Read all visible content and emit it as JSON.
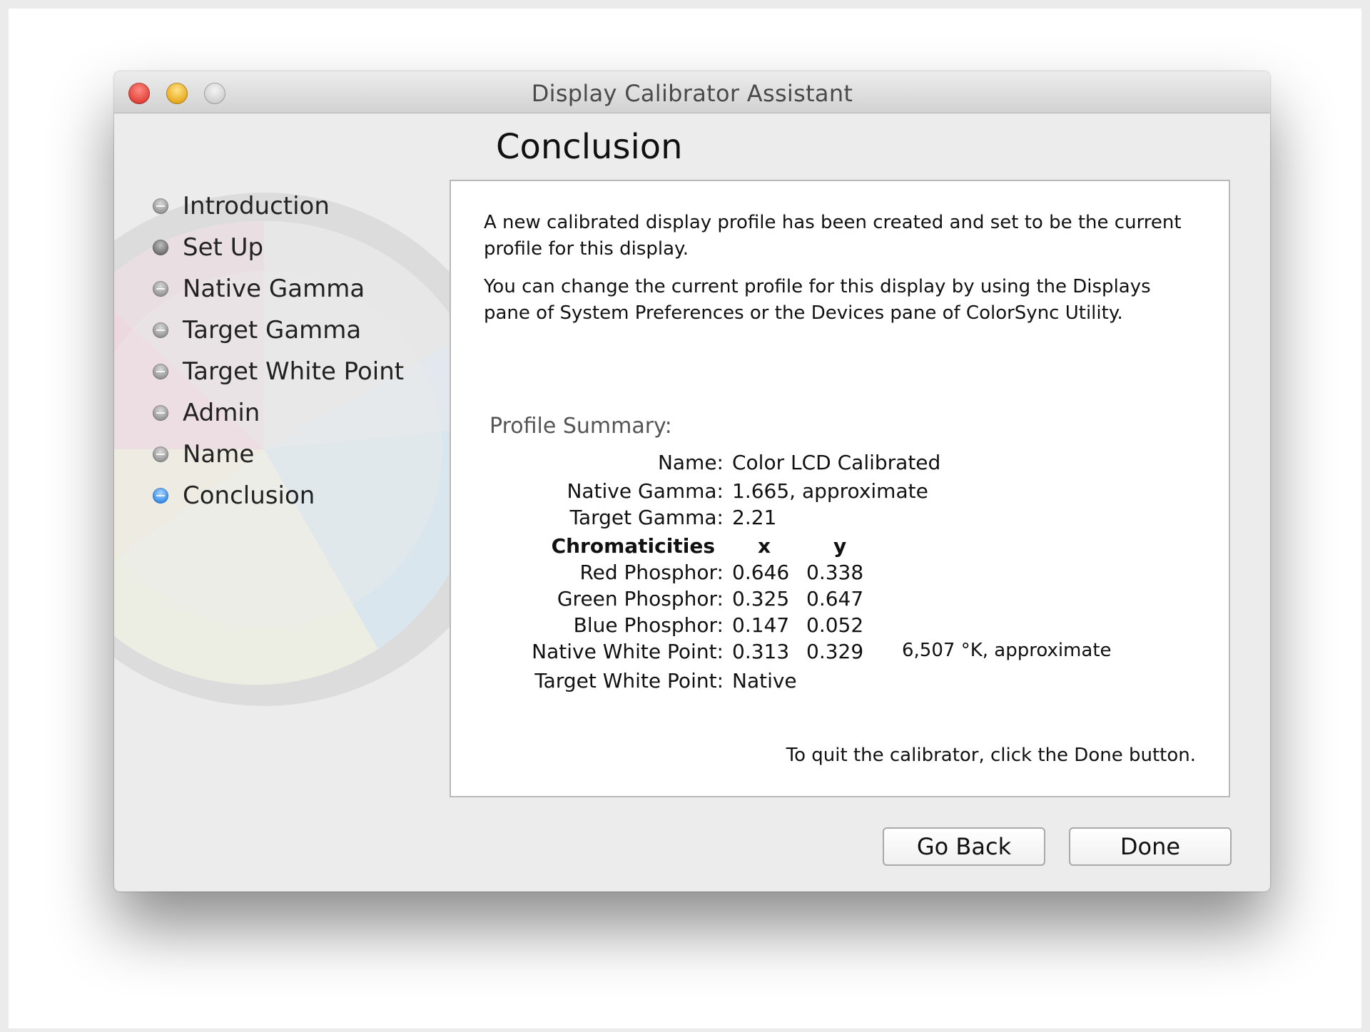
{
  "window": {
    "title": "Display Calibrator Assistant",
    "page_heading": "Conclusion"
  },
  "sidebar": {
    "steps": [
      {
        "label": "Introduction",
        "state": "pending"
      },
      {
        "label": "Set Up",
        "state": "done"
      },
      {
        "label": "Native Gamma",
        "state": "pending"
      },
      {
        "label": "Target Gamma",
        "state": "pending"
      },
      {
        "label": "Target White Point",
        "state": "pending"
      },
      {
        "label": "Admin",
        "state": "pending"
      },
      {
        "label": "Name",
        "state": "pending"
      },
      {
        "label": "Conclusion",
        "state": "active"
      }
    ]
  },
  "content": {
    "paragraph1": "A new calibrated display profile has been created and set to be the current profile for this display.",
    "paragraph2": "You can change the current profile for this display by using the Displays pane of System Preferences or the Devices pane of ColorSync Utility.",
    "summary_heading": "Profile Summary:",
    "summary": {
      "name_label": "Name:",
      "name_value": "Color LCD Calibrated",
      "native_gamma_label": "Native Gamma:",
      "native_gamma_value": "1.665, approximate",
      "target_gamma_label": "Target Gamma:",
      "target_gamma_value": "2.21",
      "chromaticities_label": "Chromaticities",
      "x_header": "x",
      "y_header": "y",
      "rows": [
        {
          "label": "Red Phosphor:",
          "x": "0.646",
          "y": "0.338"
        },
        {
          "label": "Green Phosphor:",
          "x": "0.325",
          "y": "0.647"
        },
        {
          "label": "Blue Phosphor:",
          "x": "0.147",
          "y": "0.052"
        },
        {
          "label": "Native White Point:",
          "x": "0.313",
          "y": "0.329"
        }
      ],
      "native_white_point_note": "6,507 °K, approximate",
      "target_white_point_label": "Target White Point:",
      "target_white_point_value": "Native"
    },
    "quit_text": "To quit the calibrator, click the Done button."
  },
  "buttons": {
    "go_back": "Go Back",
    "done": "Done"
  },
  "colors": {
    "active_step": "#2f87e6",
    "close_light": "#e0413a",
    "minimize_light": "#e7a81c"
  }
}
